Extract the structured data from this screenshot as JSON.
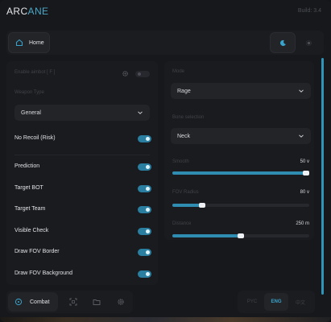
{
  "app": {
    "title_part1": "ARC",
    "title_part2": "ANE",
    "build": "Build: 3.4"
  },
  "nav": {
    "home_label": "Home"
  },
  "left": {
    "enable_label": "Enable aimbot  [ F ]",
    "weapon_type_label": "Weapon Type",
    "weapon_type_value": "General",
    "options_top": [
      {
        "label": "No Recoil (Risk)",
        "on": true
      }
    ],
    "options": [
      {
        "label": "Prediction",
        "on": true
      },
      {
        "label": "Target BOT",
        "on": true
      },
      {
        "label": "Target Team",
        "on": true
      },
      {
        "label": "Visible Check",
        "on": true
      },
      {
        "label": "Draw FOV Border",
        "on": true
      },
      {
        "label": "Draw FOV Background",
        "on": true
      }
    ]
  },
  "right": {
    "mode_label": "Mode",
    "mode_value": "Rage",
    "bone_label": "Bone selection",
    "bone_value": "Neck",
    "sliders": [
      {
        "label": "Smooth",
        "value": "50 v",
        "fraction": 1.0
      },
      {
        "label": "FOV Radius",
        "value": "80 v",
        "fraction": 0.22
      },
      {
        "label": "Distance",
        "value": "250 m",
        "fraction": 0.5
      }
    ]
  },
  "bottom": {
    "combat_label": "Combat",
    "languages": [
      "PYC",
      "ENG",
      "中文"
    ],
    "active_language": "ENG"
  },
  "colors": {
    "accent": "#2f8db2",
    "logo_accent": "#49a8c8",
    "background": "#17181b",
    "panel": "#1a1b1f"
  }
}
